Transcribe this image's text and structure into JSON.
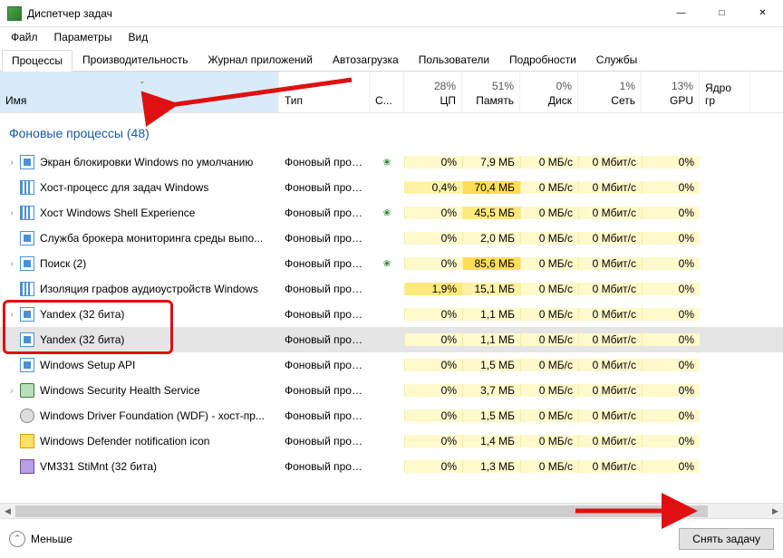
{
  "window": {
    "title": "Диспетчер задач"
  },
  "menu": {
    "file": "Файл",
    "options": "Параметры",
    "view": "Вид"
  },
  "tabs": [
    {
      "label": "Процессы",
      "active": true
    },
    {
      "label": "Производительность"
    },
    {
      "label": "Журнал приложений"
    },
    {
      "label": "Автозагрузка"
    },
    {
      "label": "Пользователи"
    },
    {
      "label": "Подробности"
    },
    {
      "label": "Службы"
    }
  ],
  "columns": {
    "name": "Имя",
    "type": "Тип",
    "status": "С...",
    "cpu": {
      "pct": "28%",
      "label": "ЦП"
    },
    "mem": {
      "pct": "51%",
      "label": "Память"
    },
    "disk": {
      "pct": "0%",
      "label": "Диск"
    },
    "net": {
      "pct": "1%",
      "label": "Сеть"
    },
    "gpu": {
      "pct": "13%",
      "label": "GPU"
    },
    "gpu_core": "Ядро гр"
  },
  "group_header": "Фоновые процессы (48)",
  "processes": [
    {
      "exp": true,
      "icon": "square",
      "name": "Экран блокировки Windows по умолчанию",
      "type": "Фоновый процесс",
      "leaf": true,
      "cpu": "0%",
      "mem": "7,9 МБ",
      "disk": "0 МБ/с",
      "net": "0 Мбит/с",
      "gpu": "0%"
    },
    {
      "exp": false,
      "icon": "bars",
      "name": "Хост-процесс для задач Windows",
      "type": "Фоновый процесс",
      "leaf": false,
      "cpu": "0,4%",
      "mem": "70,4 МБ",
      "disk": "0 МБ/с",
      "net": "0 Мбит/с",
      "gpu": "0%"
    },
    {
      "exp": true,
      "icon": "bars",
      "name": "Хост Windows Shell Experience",
      "type": "Фоновый процесс",
      "leaf": true,
      "cpu": "0%",
      "mem": "45,5 МБ",
      "disk": "0 МБ/с",
      "net": "0 Мбит/с",
      "gpu": "0%"
    },
    {
      "exp": false,
      "icon": "square",
      "name": "Служба брокера мониторинга среды выпо...",
      "type": "Фоновый процесс",
      "leaf": false,
      "cpu": "0%",
      "mem": "2,0 МБ",
      "disk": "0 МБ/с",
      "net": "0 Мбит/с",
      "gpu": "0%"
    },
    {
      "exp": true,
      "icon": "square",
      "name": "Поиск (2)",
      "type": "Фоновый процесс",
      "leaf": true,
      "cpu": "0%",
      "mem": "85,6 МБ",
      "disk": "0 МБ/с",
      "net": "0 Мбит/с",
      "gpu": "0%"
    },
    {
      "exp": false,
      "icon": "bars",
      "name": "Изоляция графов аудиоустройств Windows",
      "type": "Фоновый процесс",
      "leaf": false,
      "cpu": "1,9%",
      "mem": "15,1 МБ",
      "disk": "0 МБ/с",
      "net": "0 Мбит/с",
      "gpu": "0%"
    },
    {
      "exp": true,
      "icon": "square",
      "name": "Yandex (32 бита)",
      "type": "Фоновый процесс",
      "leaf": false,
      "cpu": "0%",
      "mem": "1,1 МБ",
      "disk": "0 МБ/с",
      "net": "0 Мбит/с",
      "gpu": "0%"
    },
    {
      "exp": false,
      "icon": "square",
      "name": "Yandex (32 бита)",
      "type": "Фоновый процесс",
      "leaf": false,
      "cpu": "0%",
      "mem": "1,1 МБ",
      "disk": "0 МБ/с",
      "net": "0 Мбит/с",
      "gpu": "0%",
      "selected": true
    },
    {
      "exp": false,
      "icon": "square",
      "name": "Windows Setup API",
      "type": "Фоновый процесс",
      "leaf": false,
      "cpu": "0%",
      "mem": "1,5 МБ",
      "disk": "0 МБ/с",
      "net": "0 Мбит/с",
      "gpu": "0%"
    },
    {
      "exp": true,
      "icon": "shield",
      "name": "Windows Security Health Service",
      "type": "Фоновый процесс",
      "leaf": false,
      "cpu": "0%",
      "mem": "3,7 МБ",
      "disk": "0 МБ/с",
      "net": "0 Мбит/с",
      "gpu": "0%"
    },
    {
      "exp": false,
      "icon": "gear",
      "name": "Windows Driver Foundation (WDF) - хост-пр...",
      "type": "Фоновый процесс",
      "leaf": false,
      "cpu": "0%",
      "mem": "1,5 МБ",
      "disk": "0 МБ/с",
      "net": "0 Мбит/с",
      "gpu": "0%"
    },
    {
      "exp": false,
      "icon": "yellow",
      "name": "Windows Defender notification icon",
      "type": "Фоновый процесс",
      "leaf": false,
      "cpu": "0%",
      "mem": "1,4 МБ",
      "disk": "0 МБ/с",
      "net": "0 Мбит/с",
      "gpu": "0%"
    },
    {
      "exp": false,
      "icon": "photo",
      "name": "VM331 StiMnt (32 бита)",
      "type": "Фоновый процесс",
      "leaf": false,
      "cpu": "0%",
      "mem": "1,3 МБ",
      "disk": "0 МБ/с",
      "net": "0 Мбит/с",
      "gpu": "0%"
    }
  ],
  "footer": {
    "less": "Меньше",
    "end_task": "Снять задачу"
  }
}
